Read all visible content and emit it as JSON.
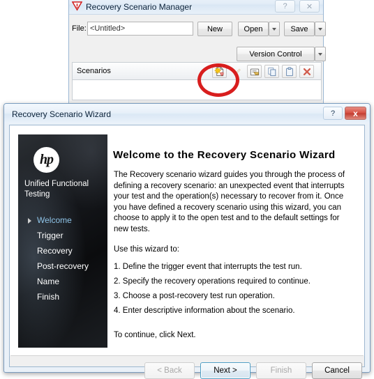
{
  "manager": {
    "title": "Recovery Scenario Manager",
    "app_icon": "recovery-scenario-icon",
    "help_label": "?",
    "close_label": "✕",
    "file_label": "File:",
    "file_value": "<Untitled>",
    "buttons": {
      "new": "New",
      "open": "Open",
      "save": "Save",
      "version_control": "Version Control"
    },
    "scenarios_label": "Scenarios",
    "toolbar_icons": [
      {
        "name": "new-scenario-icon",
        "state": "enabled-highlighted"
      },
      {
        "name": "edit-scenario-icon",
        "state": "disabled"
      },
      {
        "name": "scenario-properties-icon",
        "state": "enabled"
      },
      {
        "name": "copy-scenario-icon",
        "state": "enabled"
      },
      {
        "name": "paste-scenario-icon",
        "state": "enabled"
      },
      {
        "name": "delete-scenario-icon",
        "state": "enabled"
      }
    ],
    "annotation": {
      "shape": "ellipse",
      "color": "#d81e1e",
      "target": "new-scenario-icon"
    }
  },
  "wizard": {
    "title": "Recovery Scenario Wizard",
    "help_label": "?",
    "close_label": "x",
    "product_name": "Unified Functional Testing",
    "logo_text": "hp",
    "steps": [
      {
        "label": "Welcome",
        "active": true
      },
      {
        "label": "Trigger",
        "active": false
      },
      {
        "label": "Recovery",
        "active": false
      },
      {
        "label": "Post-recovery",
        "active": false
      },
      {
        "label": "Name",
        "active": false
      },
      {
        "label": "Finish",
        "active": false
      }
    ],
    "heading": "Welcome to the Recovery Scenario Wizard",
    "intro": "The Recovery scenario wizard guides you through the process of defining a recovery scenario: an unexpected event that interrupts your test and the operation(s) necessary to recover from it. Once you have defined a recovery scenario using this wizard, you can choose to apply it to the open test and to the default settings for new tests.",
    "use_label": "Use this wizard to:",
    "use_items": [
      "1. Define the trigger event that interrupts the test run.",
      "2. Specify the recovery operations required to continue.",
      "3. Choose a post-recovery test run operation.",
      "4. Enter descriptive information about the scenario."
    ],
    "continue_text": "To continue, click Next.",
    "footer_buttons": {
      "back": "< Back",
      "next": "Next >",
      "finish": "Finish",
      "cancel": "Cancel"
    },
    "accent_color": "#8fc4e8",
    "close_color": "#c23c30"
  }
}
